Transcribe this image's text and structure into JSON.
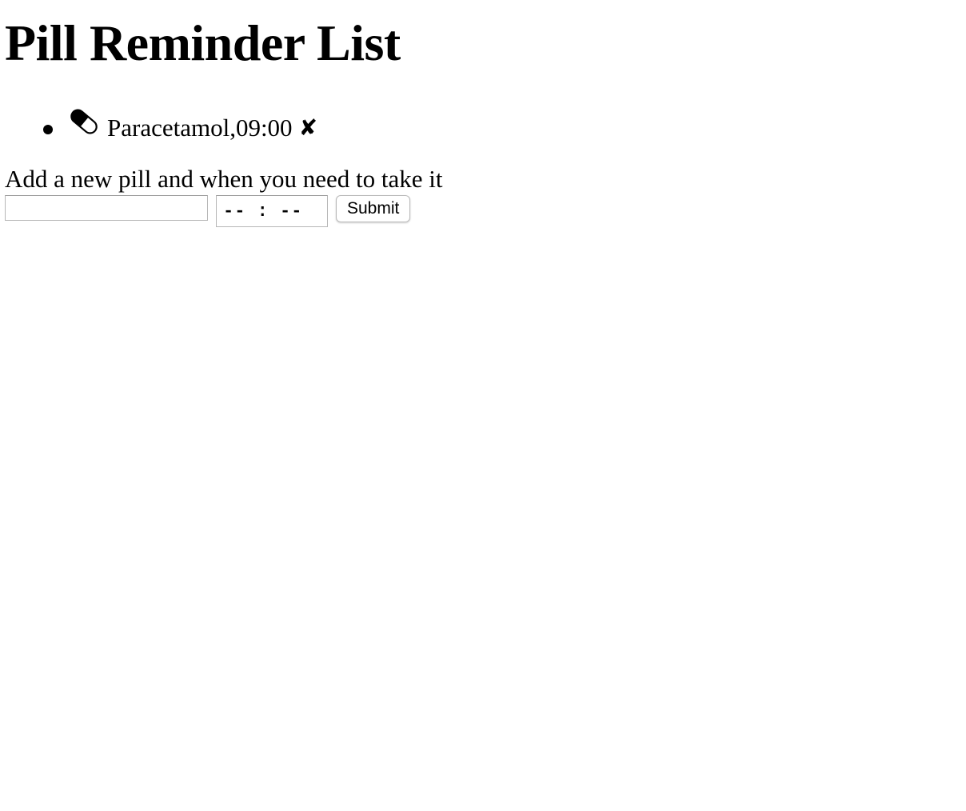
{
  "header": {
    "title": "Pill Reminder List"
  },
  "pills": [
    {
      "icon": "pill-capsule-icon",
      "text": "Paracetamol,09:00",
      "delete_glyph": "✘"
    }
  ],
  "form": {
    "label": "Add a new pill and when you need to take it",
    "name_value": "",
    "time_placeholder": "-- : --",
    "submit_label": "Submit"
  }
}
